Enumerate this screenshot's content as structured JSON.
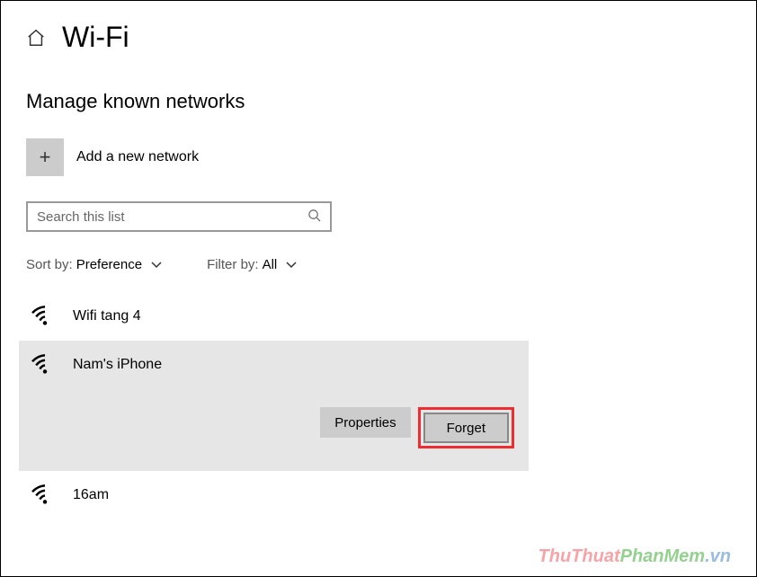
{
  "header": {
    "title": "Wi-Fi"
  },
  "subtitle": "Manage known networks",
  "add_network": {
    "plus": "+",
    "label": "Add a new network"
  },
  "search": {
    "placeholder": "Search this list"
  },
  "filters": {
    "sort_label": "Sort by:",
    "sort_value": "Preference",
    "filter_label": "Filter by:",
    "filter_value": "All"
  },
  "networks": {
    "items": [
      {
        "name": "Wifi tang 4"
      },
      {
        "name": "Nam's iPhone"
      },
      {
        "name": "16am"
      }
    ],
    "selected_index": 1,
    "actions": {
      "properties": "Properties",
      "forget": "Forget"
    }
  },
  "watermark": {
    "a": "ThuThuat",
    "b": "PhanMem",
    "c": ".vn"
  }
}
